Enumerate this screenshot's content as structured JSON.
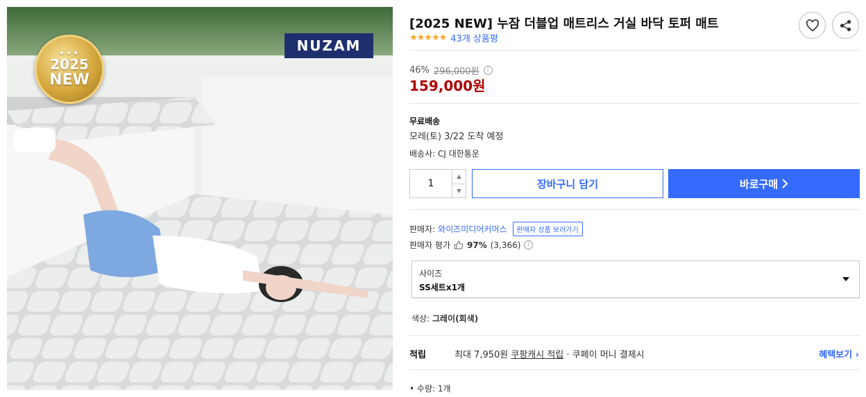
{
  "product": {
    "title": "[2025 NEW] 누잠 더블업 매트리스 거실 바닥 토퍼 매트",
    "stars_text": "★★★★★",
    "review_count": "43개 상품평",
    "discount_rate": "46%",
    "original_price": "296,000원",
    "sale_price": "159,000원"
  },
  "image": {
    "badge_year": "2025",
    "badge_new": "NEW",
    "badge_stars": "★★★",
    "brand_logo": "NUZAM"
  },
  "shipping": {
    "title": "무료배송",
    "arrival": "모레(토) 3/22 도착 예정",
    "carrier": "배송사: CJ 대한통운"
  },
  "purchase": {
    "quantity": "1",
    "cart_label": "장바구니 담기",
    "buy_label": "바로구매"
  },
  "seller": {
    "label": "판매자:",
    "name": "와이즈미디어커머스",
    "tip": "판매자 상품 보러가기",
    "rating_label": "판매자 평가",
    "rating_percent": "97%",
    "rating_count": "(3,366)"
  },
  "option": {
    "label": "사이즈",
    "value": "SS세트x1개"
  },
  "color": {
    "label": "색상:",
    "value": "그레이(회색)"
  },
  "reward": {
    "label": "적립",
    "prefix": "최대 7,950원",
    "link": "쿠팡캐시 적립",
    "suffix": "· 쿠페이 머니 결제시",
    "more": "혜택보기"
  },
  "bullets": [
    "수량: 1개"
  ],
  "colors": {
    "accent": "#346aff",
    "price": "#ae0000",
    "star": "#f5a623"
  }
}
